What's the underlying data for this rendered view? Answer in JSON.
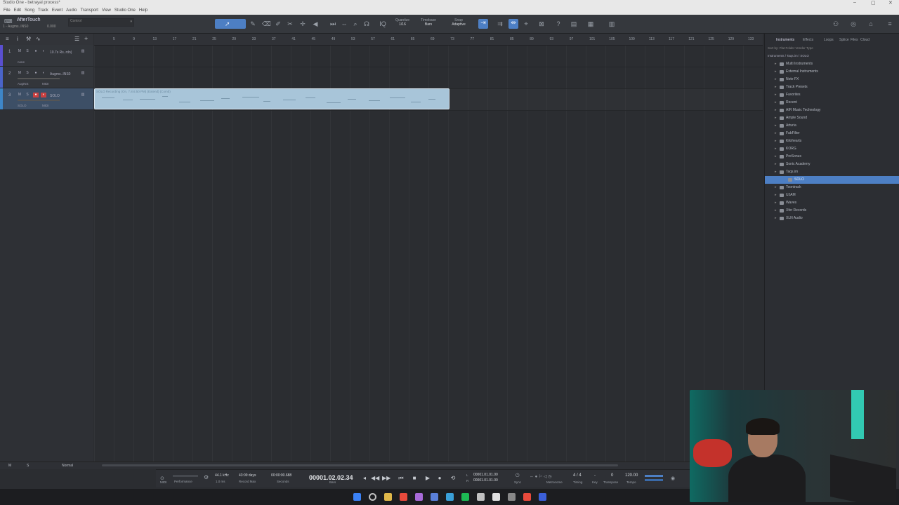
{
  "window": {
    "title": "Studio One - betrayal process*"
  },
  "menu": [
    "File",
    "Edit",
    "Song",
    "Track",
    "Event",
    "Audio",
    "Transport",
    "View",
    "Studio One",
    "Help"
  ],
  "toolbar": {
    "instrument_label": "AfterTouch",
    "sub_label": "1 - Augms..INS0",
    "sub_value": "0.000",
    "control_placeholder": "Control",
    "quantize_label": "Quantize",
    "quantize_value": "1/16",
    "timebase_label": "Timebase",
    "timebase_value": "Bars",
    "snap_label": "Snap",
    "snap_value": "Adaptive"
  },
  "tracks": [
    {
      "num": "1",
      "name": "10.7s Rs..rdn)",
      "sub": "none",
      "sub2": "",
      "color": "#5a4fd1"
    },
    {
      "num": "2",
      "name": "Augms..INS0",
      "sub": "AugINS",
      "sub2": "MIDI",
      "color": "#4a64c9"
    },
    {
      "num": "3",
      "name": "SOLO",
      "sub": "SOLO",
      "sub2": "MIDI",
      "color": "#3e86c8",
      "selected": true
    }
  ],
  "ruler_ticks": [
    "5",
    "9",
    "13",
    "17",
    "21",
    "25",
    "29",
    "33",
    "37",
    "41",
    "45",
    "49",
    "53",
    "57",
    "61",
    "65",
    "69",
    "73",
    "77",
    "81",
    "85",
    "89",
    "93",
    "97",
    "101",
    "105",
    "109",
    "113",
    "117",
    "121",
    "125",
    "129",
    "133"
  ],
  "clip": {
    "label": "SOLO Recording (On, 7.8.6:50 PM) (Extend) (Comb)"
  },
  "bottom": {
    "mode": "Normal"
  },
  "browser": {
    "tabs": [
      "Instruments",
      "Effects",
      "Loops",
      "Splice",
      "Files",
      "Cloud"
    ],
    "sort_label": "Sort by:  Flat  Folder  Vendor  Type",
    "path": "Instruments  /  Taqs.im  /  SOLO",
    "items": [
      {
        "label": "Multi Instruments",
        "indent": 1
      },
      {
        "label": "External Instruments",
        "indent": 1
      },
      {
        "label": "Note FX",
        "indent": 1
      },
      {
        "label": "Track Presets",
        "indent": 1
      },
      {
        "label": "Favorites",
        "indent": 1
      },
      {
        "label": "Recent",
        "indent": 1
      },
      {
        "label": "AIR Music Technology",
        "indent": 1
      },
      {
        "label": "Ample Sound",
        "indent": 1
      },
      {
        "label": "Arturia",
        "indent": 1
      },
      {
        "label": "FabFilter",
        "indent": 1
      },
      {
        "label": "Kilohearts",
        "indent": 1
      },
      {
        "label": "KORG",
        "indent": 1
      },
      {
        "label": "PreSonus",
        "indent": 1
      },
      {
        "label": "Sonic Academy",
        "indent": 1
      },
      {
        "label": "Taqs.im",
        "indent": 1
      },
      {
        "label": "SOLO",
        "indent": 2,
        "selected": true
      },
      {
        "label": "Toontrack",
        "indent": 1
      },
      {
        "label": "UJAM",
        "indent": 1
      },
      {
        "label": "Waves",
        "indent": 1
      },
      {
        "label": "Xfer Records",
        "indent": 1
      },
      {
        "label": "XLN Audio",
        "indent": 1
      }
    ]
  },
  "transport": {
    "midi_label": "MIDI",
    "performance_label": "Performance",
    "sample_rate": "44.1 kHz",
    "latency": "1.0 ms",
    "record_days": "43:09 days",
    "record_max_label": "Record Max",
    "seconds_value": "00:00:00.688",
    "seconds_label": "Seconds",
    "position": "00001.02.02.34",
    "position_label": "Bars",
    "loop_start": "00001.01.01.00",
    "loop_end": "00001.01.01.00",
    "sync_label": "Sync",
    "metronome_label": "Metronome",
    "time_sig": "4 / 4",
    "timing_label": "Timing",
    "key_value": "-",
    "key_label": "Key",
    "transpose_value": "0",
    "transpose_label": "Transpose",
    "tempo_value": "120.00",
    "tempo_label": "Tempo"
  },
  "taskbar_icons": [
    "windows-start-icon",
    "search-icon",
    "file-explorer-icon",
    "chrome-icon",
    "app-icon",
    "app-icon-2",
    "telegram-icon",
    "spotify-icon",
    "app-icon-3",
    "capcut-icon",
    "app-icon-4",
    "chrome-icon-2",
    "studio-one-icon"
  ],
  "colors": {
    "accent": "#4d7fc4",
    "clip": "#a8c5d9"
  }
}
